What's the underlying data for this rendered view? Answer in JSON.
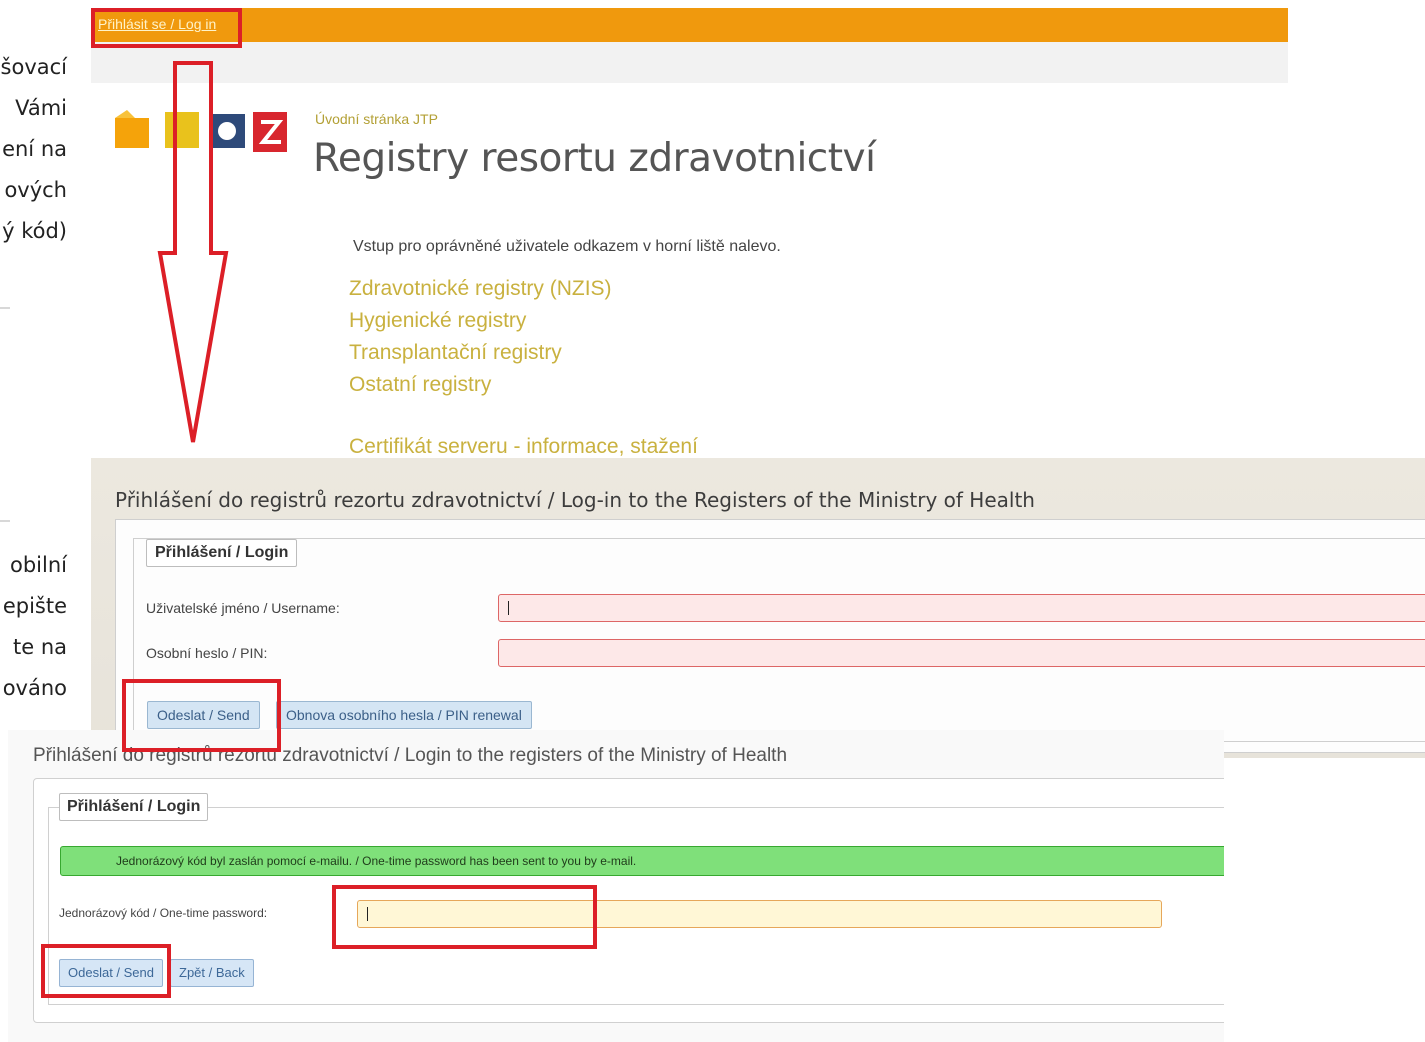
{
  "doc_fragments": [
    "šovací",
    "Vámi",
    "ení na",
    "ových",
    "ý kód)",
    "obilní",
    "epište",
    "te na",
    "ováno"
  ],
  "portal": {
    "login_link": "Přihlásit se / Log in",
    "breadcrumb": "Úvodní stránka JTP",
    "title": "Registry resortu zdravotnictví",
    "intro": "Vstup pro oprávněné uživatele odkazem v horní liště nalevo.",
    "registry_links": [
      "Zdravotnické registry (NZIS)",
      "Hygienické registry",
      "Transplantační registry",
      "Ostatní registry"
    ],
    "certificate_link": "Certifikát serveru - informace, stažení",
    "logo_colors": [
      "#f5a30a",
      "#e9c21c",
      "#2e4a7a",
      "#d8262e"
    ]
  },
  "login_form": {
    "title": "Přihlášení do registrů rezortu zdravotnictví / Log-in to the Registers of the Ministry of Health",
    "legend": "Přihlášení / Login",
    "username_label": "Uživatelské jméno / Username:",
    "username_value": "",
    "pin_label": "Osobní heslo / PIN:",
    "pin_value": "",
    "send_button": "Odeslat / Send",
    "renewal_button": "Obnova osobního hesla / PIN renewal"
  },
  "otp_form": {
    "title": "Přihlášení do registrů rezortu zdravotnictví / Login to the registers of the Ministry of Health",
    "legend": "Přihlášení / Login",
    "notice": "Jednorázový kód byl zaslán pomocí e-mailu. / One-time password has been sent to you by e-mail.",
    "otp_label": "Jednorázový kód / One-time password:",
    "otp_value": "",
    "send_button": "Odeslat / Send",
    "back_button": "Zpět / Back"
  },
  "colors": {
    "highlight_red": "#dc1f27",
    "header_orange": "#f0990d",
    "link_gold": "#c9b13f",
    "notice_green": "#7fe07a"
  }
}
